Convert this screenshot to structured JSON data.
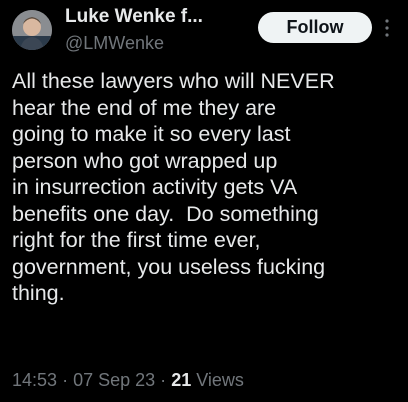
{
  "author": {
    "name": "Luke Wenke f...",
    "handle": "@LMWenke",
    "avatar_icon": "user-avatar"
  },
  "follow_label": "Follow",
  "more_icon": "more-options-icon",
  "tweet_text": "All these lawyers who will NEVER\nhear the end of me they are\ngoing to make it so every last\nperson who got wrapped up\nin insurrection activity gets VA\nbenefits one day.  Do something\nright for the first time ever,\ngovernment, you useless fucking\nthing.",
  "meta": {
    "time": "14:53",
    "date": "07 Sep 23",
    "separator": "·",
    "views_count": "21",
    "views_label": "Views"
  },
  "colors": {
    "background": "#000000",
    "text": "#e7e9ea",
    "secondary": "#71767b",
    "button_bg": "#eff3f4",
    "button_text": "#0f1419"
  }
}
